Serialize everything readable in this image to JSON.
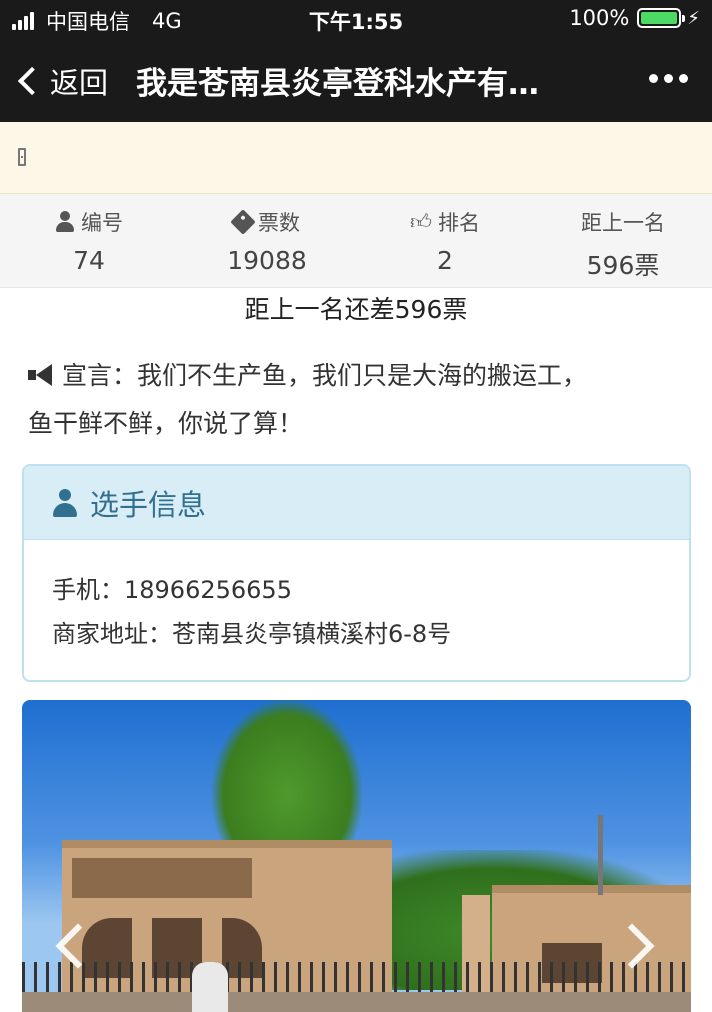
{
  "status_bar": {
    "carrier": "中国电信",
    "network": "4G",
    "time": "下午1:55",
    "battery": "100%",
    "battery_level": 1.0
  },
  "nav": {
    "back_label": "返回",
    "title": "我是苍南县炎亭登科水产有…"
  },
  "stats": [
    {
      "icon": "user-icon",
      "label": "编号",
      "value": "74"
    },
    {
      "icon": "tag-icon",
      "label": "票数",
      "value": "19088"
    },
    {
      "icon": "thumbs-up-icon",
      "label": "排名",
      "value": "2"
    },
    {
      "icon": "",
      "label": "距上一名",
      "value": "596票"
    }
  ],
  "gap_text": "距上一名还差596票",
  "slogan": {
    "line1": "宣言：我们不生产鱼，我们只是大海的搬运工，",
    "line2": "鱼干鲜不鲜，你说了算！"
  },
  "player_card": {
    "title": "选手信息",
    "phone": "手机：18966256655",
    "address": "商家地址：苍南县炎亭镇横溪村6-8号"
  },
  "colors": {
    "nav_bg": "#1a1a1a",
    "notice_bg": "#fcf7e6",
    "card_head_bg": "#d9edf7",
    "card_head_text": "#31708f",
    "battery_green": "#4cd964"
  }
}
